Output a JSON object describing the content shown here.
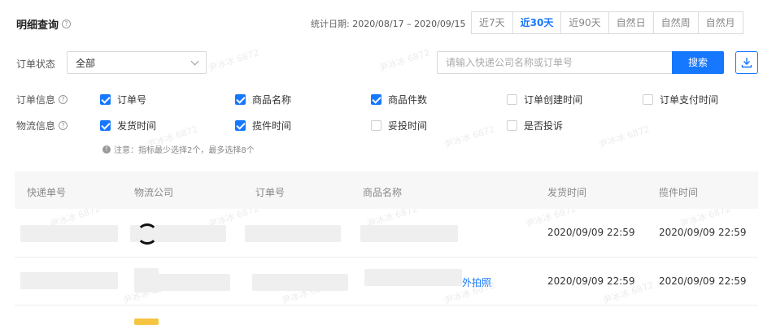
{
  "header": {
    "title": "明细查询",
    "stat_label": "统计日期:",
    "stat_value": "2020/08/17 – 2020/09/15",
    "ranges": [
      "近7天",
      "近30天",
      "近90天",
      "自然日",
      "自然周",
      "自然月"
    ],
    "active_range": "近30天"
  },
  "filter": {
    "status_label": "订单状态",
    "status_value": "全部",
    "search_placeholder": "请输入快递公司名称或订单号",
    "search_button": "搜索"
  },
  "order_info": {
    "label": "订单信息",
    "options": [
      {
        "label": "订单号",
        "checked": true
      },
      {
        "label": "商品名称",
        "checked": true
      },
      {
        "label": "商品件数",
        "checked": true
      },
      {
        "label": "订单创建时间",
        "checked": false
      },
      {
        "label": "订单支付时间",
        "checked": false
      }
    ]
  },
  "logistics_info": {
    "label": "物流信息",
    "options": [
      {
        "label": "发货时间",
        "checked": true
      },
      {
        "label": "揽件时间",
        "checked": true
      },
      {
        "label": "妥投时间",
        "checked": false
      },
      {
        "label": "是否投诉",
        "checked": false
      }
    ],
    "note": "注意：指标最少选择2个，最多选择8个"
  },
  "table": {
    "columns": [
      "快递单号",
      "物流公司",
      "订单号",
      "商品名称",
      "发货时间",
      "揽件时间"
    ],
    "rows": [
      {
        "product": "",
        "ship_time": "2020/09/09 22:59",
        "pickup_time": "2020/09/09 22:59"
      },
      {
        "product": "外拍照",
        "ship_time": "2020/09/09 22:59",
        "pickup_time": "2020/09/09 22:59"
      }
    ]
  },
  "watermark": "尹冰冰 6872",
  "colors": {
    "accent": "#1677ff"
  }
}
